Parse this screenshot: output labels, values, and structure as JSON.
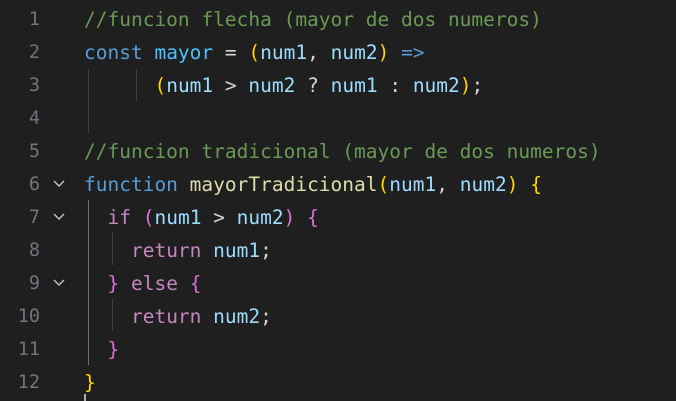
{
  "editor": {
    "lines": [
      {
        "num": "1",
        "fold": false,
        "tokens": [
          {
            "t": "cm",
            "v": "//funcion flecha (mayor de dos numeros)"
          }
        ]
      },
      {
        "num": "2",
        "fold": false,
        "tokens": [
          {
            "t": "kw",
            "v": "const"
          },
          {
            "t": "op",
            "v": " "
          },
          {
            "t": "const",
            "v": "mayor"
          },
          {
            "t": "op",
            "v": " = "
          },
          {
            "t": "b1",
            "v": "("
          },
          {
            "t": "var",
            "v": "num1"
          },
          {
            "t": "pn",
            "v": ", "
          },
          {
            "t": "var",
            "v": "num2"
          },
          {
            "t": "b1",
            "v": ")"
          },
          {
            "t": "op",
            "v": " "
          },
          {
            "t": "arrow",
            "v": "=>"
          }
        ]
      },
      {
        "num": "3",
        "fold": false,
        "tokens": [
          {
            "t": "op",
            "v": "      "
          },
          {
            "t": "b1",
            "v": "("
          },
          {
            "t": "var",
            "v": "num1"
          },
          {
            "t": "op",
            "v": " > "
          },
          {
            "t": "var",
            "v": "num2"
          },
          {
            "t": "op",
            "v": " ? "
          },
          {
            "t": "var",
            "v": "num1"
          },
          {
            "t": "op",
            "v": " : "
          },
          {
            "t": "var",
            "v": "num2"
          },
          {
            "t": "b1",
            "v": ")"
          },
          {
            "t": "pn",
            "v": ";"
          }
        ]
      },
      {
        "num": "4",
        "fold": false,
        "tokens": []
      },
      {
        "num": "5",
        "fold": false,
        "tokens": [
          {
            "t": "cm",
            "v": "//funcion tradicional (mayor de dos numeros)"
          }
        ]
      },
      {
        "num": "6",
        "fold": true,
        "tokens": [
          {
            "t": "kw",
            "v": "function"
          },
          {
            "t": "op",
            "v": " "
          },
          {
            "t": "fn",
            "v": "mayorTradicional"
          },
          {
            "t": "b1",
            "v": "("
          },
          {
            "t": "var",
            "v": "num1"
          },
          {
            "t": "pn",
            "v": ", "
          },
          {
            "t": "var",
            "v": "num2"
          },
          {
            "t": "b1",
            "v": ")"
          },
          {
            "t": "op",
            "v": " "
          },
          {
            "t": "b1",
            "v": "{"
          }
        ]
      },
      {
        "num": "7",
        "fold": true,
        "tokens": [
          {
            "t": "op",
            "v": "  "
          },
          {
            "t": "ctl",
            "v": "if"
          },
          {
            "t": "op",
            "v": " "
          },
          {
            "t": "b2",
            "v": "("
          },
          {
            "t": "var",
            "v": "num1"
          },
          {
            "t": "op",
            "v": " > "
          },
          {
            "t": "var",
            "v": "num2"
          },
          {
            "t": "b2",
            "v": ")"
          },
          {
            "t": "op",
            "v": " "
          },
          {
            "t": "b2",
            "v": "{"
          }
        ]
      },
      {
        "num": "8",
        "fold": false,
        "tokens": [
          {
            "t": "op",
            "v": "    "
          },
          {
            "t": "ctl",
            "v": "return"
          },
          {
            "t": "op",
            "v": " "
          },
          {
            "t": "var",
            "v": "num1"
          },
          {
            "t": "pn",
            "v": ";"
          }
        ]
      },
      {
        "num": "9",
        "fold": true,
        "tokens": [
          {
            "t": "op",
            "v": "  "
          },
          {
            "t": "b2",
            "v": "}"
          },
          {
            "t": "op",
            "v": " "
          },
          {
            "t": "ctl",
            "v": "else"
          },
          {
            "t": "op",
            "v": " "
          },
          {
            "t": "b2",
            "v": "{"
          }
        ]
      },
      {
        "num": "10",
        "fold": false,
        "tokens": [
          {
            "t": "op",
            "v": "    "
          },
          {
            "t": "ctl",
            "v": "return"
          },
          {
            "t": "op",
            "v": " "
          },
          {
            "t": "var",
            "v": "num2"
          },
          {
            "t": "pn",
            "v": ";"
          }
        ]
      },
      {
        "num": "11",
        "fold": false,
        "tokens": [
          {
            "t": "op",
            "v": "  "
          },
          {
            "t": "b2",
            "v": "}"
          }
        ]
      },
      {
        "num": "12",
        "fold": false,
        "tokens": [
          {
            "t": "b1",
            "v": "}"
          }
        ]
      }
    ]
  }
}
